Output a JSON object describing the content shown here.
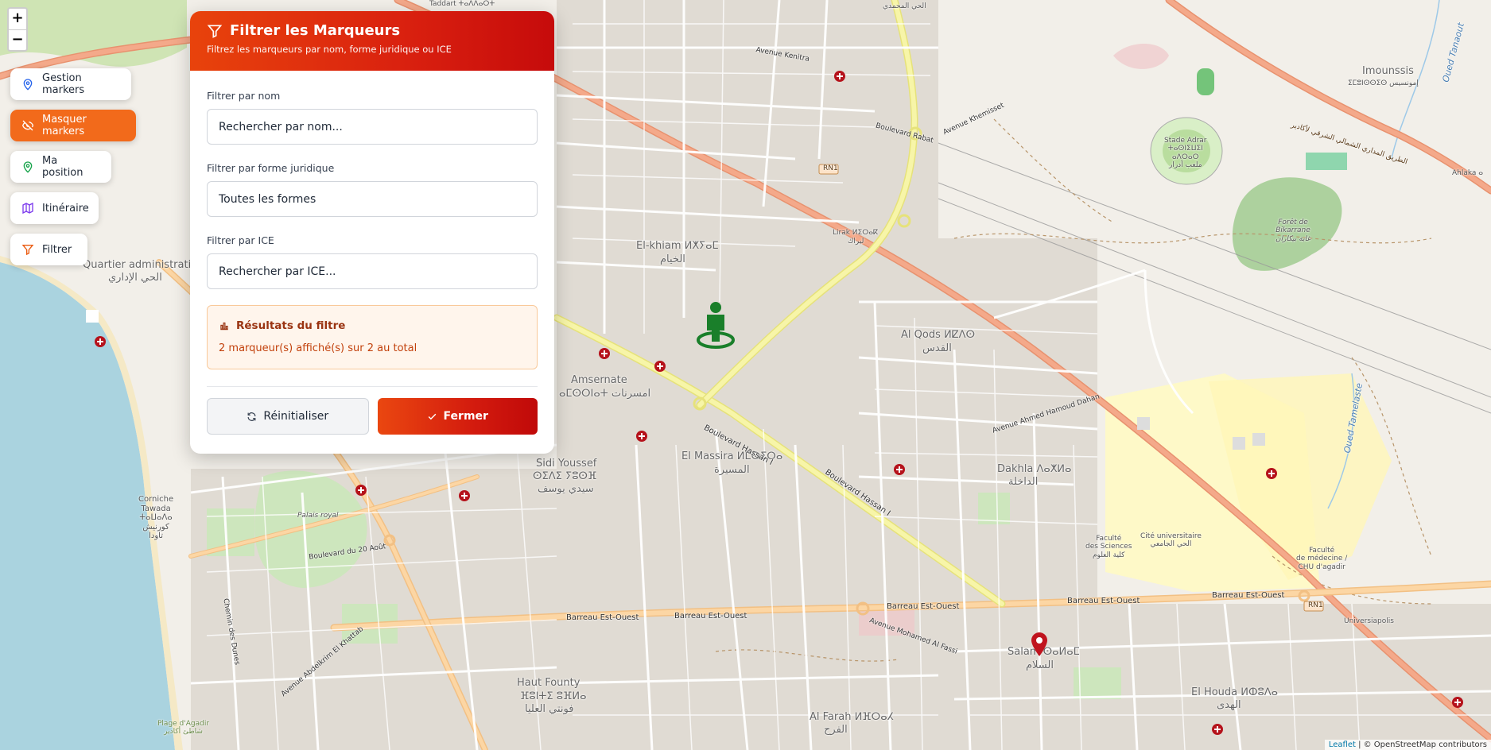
{
  "zoom": {
    "in_label": "+",
    "out_label": "−"
  },
  "toolbar": {
    "items": [
      {
        "label": "Gestion markers",
        "icon": "map-pin-icon",
        "active": false
      },
      {
        "label": "Masquer markers",
        "icon": "eye-off-icon",
        "active": true
      },
      {
        "label": "Ma position",
        "icon": "location-icon",
        "active": false
      },
      {
        "label": "Itinéraire",
        "icon": "map-icon",
        "active": false
      },
      {
        "label": "Filtrer",
        "icon": "filter-icon",
        "active": false
      }
    ]
  },
  "filter_panel": {
    "title": "Filtrer les Marqueurs",
    "subtitle": "Filtrez les marqueurs par nom, forme juridique ou ICE",
    "name_label": "Filtrer par nom",
    "name_placeholder": "Rechercher par nom...",
    "legal_form_label": "Filtrer par forme juridique",
    "legal_form_value": "Toutes les formes",
    "ice_label": "Filtrer par ICE",
    "ice_placeholder": "Rechercher par ICE...",
    "results_title": "Résultats du filtre",
    "results_text": "2 marqueur(s) affiché(s) sur 2 au total",
    "reset_label": "Réinitialiser",
    "close_label": "Fermer"
  },
  "map_labels": {
    "taddart": "Taddart ⵜⴰⴷⴷⴰⵔⵜ",
    "el_mohammadi": "الحي المحمدي",
    "imounssis": "Imounssis",
    "imounssis_tif": "ⵉⵎⵓⵏⵙⵙⵉⵙ إمونسيس",
    "imounssis_ar": "إمونسيس",
    "stade": "Stade Adrar\nⵜⴰⵙⵏⵉⵡⵉⵏ\nⴰⴷⵔⴰⵔ\nملعب أدرار",
    "ahlaka": "Ahlaka ⴰ",
    "foret": "Forêt de\nBikarrane\nغابة بيكاران",
    "quartier_admin": "Quartier administratif",
    "quartier_admin_ar": "الحي الإداري",
    "el_khiam": "El-khiam ⵍⵅⵢⴰⵎ",
    "el_khiam_ar": "الخيام",
    "lirak": "Lirak ⵍⵉⵔⴰⴽ",
    "lirak_ar": "ليراك",
    "al_qods": "Al Qods ⵍⵇⴷⵙ",
    "al_qods_ar": "القدس",
    "amsernate": "Amsernate",
    "amsernate_ar": "ⴰⵎⵙⵔⵏⴰⵜ امسرنات",
    "el_massira": "El Massira ⵍⵎⵙⵉⵔⴰ",
    "el_massira_ar": "المسيرة",
    "sidi_youssef": "Sidi Youssef",
    "sidi_youssef_tif": "ⵙⵉⴷⵉ ⵢⵓⵙⴼ",
    "sidi_youssef_ar": "سيدي يوسف",
    "dakhla": "Dakhla ⴷⴰⵅⵍⴰ",
    "dakhla_ar": "الداخلة",
    "corniche": "Corniche\nTawada\nⵜⴰⵡⴰⴷⴰ\nكورنيش\nتاودا",
    "palais": "Palais royal",
    "cite_univ": "Cité universitaire\nالحي الجامعي",
    "faculte_sciences": "Faculté\ndes Sciences\nكلية العلوم",
    "faculte_medecine": "Faculté\nde médecine /\nCHU d'agadir",
    "universiapolis": "Universiapolis",
    "salam": "Salam ⵙⴰⵍⴰⵎ",
    "salam_ar": "السلام",
    "el_houda": "El Houda ⵍⵀⵓⴷⴰ",
    "el_houda_ar": "الهدى",
    "haut_founty": "Haut Founty",
    "haut_founty_tif": "ⴼⵓⵏⵜⵉ ⵓⴼⵍⴰ",
    "haut_founty_ar": "فونتي العليا",
    "al_farah": "Al Farah ⵍⴼⵔⴰⵃ",
    "al_farah_ar": "الفرح",
    "plage": "Plage d'Agadir\nشاطئ أكادير",
    "boulevard_hassan": "Boulevard Hassan I",
    "barreau_est_ouest": "Barreau Est-Ouest",
    "rn1": "RN1",
    "oued_tanaout": "Oued Tanaout",
    "oued_tamelaste": "Oued Tamelaste",
    "avenue_mohamed_fassi": "Avenue Mohamed Al Fassi",
    "avenue_ahmed_dahan": "Avenue Ahmed Hamoud Dahan",
    "boulevard_rabat": "Boulevard Rabat",
    "avenue_khemisset": "Avenue Khemisset",
    "avenue_kenitra": "Avenue Kenitra",
    "boulevard_20_aout": "Boulevard du 20 Août",
    "avenue_abdelkrim": "Avenue Abdelkrim El Khattab",
    "chemin_dunes": "Chemin des Dunes",
    "route_express": "الطريق المداري الشمالي الشرقي لأكادير"
  },
  "attribution": {
    "leaflet": "Leaflet",
    "rest": " | © OpenStreetMap contributors"
  },
  "colors": {
    "accent": "#f26a1b",
    "header_gradient_start": "#e8430c",
    "header_gradient_end": "#c60b0b",
    "results_bg": "#fff5ec",
    "results_text": "#c2410c",
    "marker_green": "#1a7f2a",
    "marker_red": "#c0141e"
  }
}
